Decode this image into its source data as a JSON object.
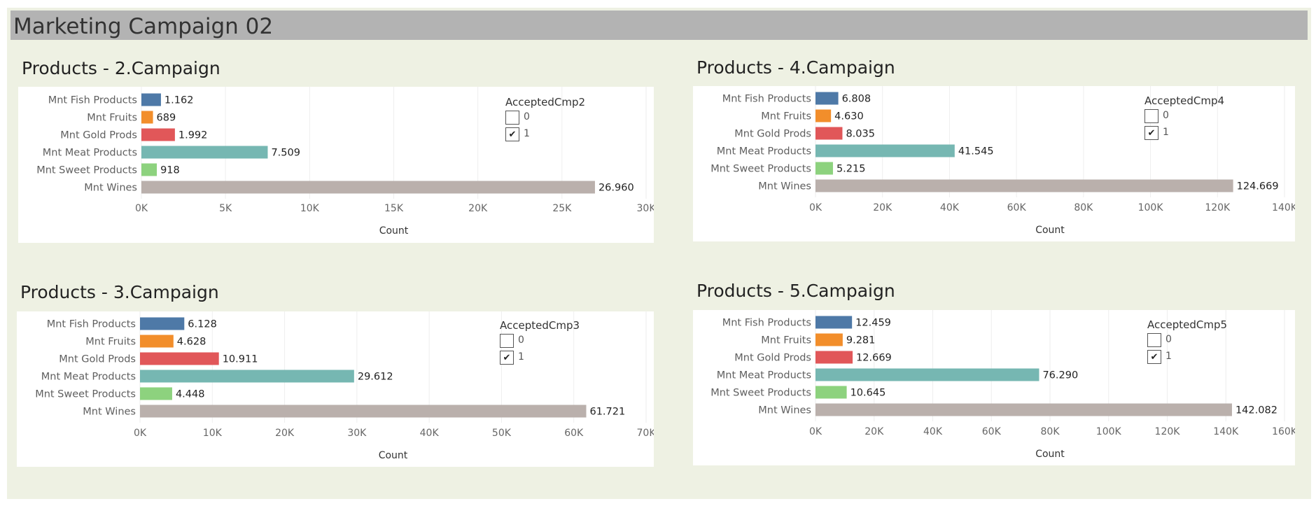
{
  "title": "Marketing Campaign 02",
  "colors": {
    "background": "#eef1e3",
    "title_bar": "#b3b3b3",
    "categories": [
      "#4e79a7",
      "#f28e2b",
      "#e15759",
      "#76b7b2",
      "#8dd27e",
      "#bab0ac"
    ]
  },
  "chart_data": [
    {
      "type": "bar",
      "orientation": "horizontal",
      "title": "Products - 2.Campaign",
      "categories": [
        "Mnt Fish Products",
        "Mnt Fruits",
        "Mnt Gold Prods",
        "Mnt Meat Products",
        "Mnt Sweet Products",
        "Mnt Wines"
      ],
      "values": [
        1162,
        689,
        1992,
        7509,
        918,
        26960
      ],
      "value_labels": [
        "1.162",
        "689",
        "1.992",
        "7.509",
        "918",
        "26.960"
      ],
      "xlabel": "Count",
      "ticks": [
        0,
        5000,
        10000,
        15000,
        20000,
        25000,
        30000
      ],
      "tick_labels": [
        "0K",
        "5K",
        "10K",
        "15K",
        "20K",
        "25K",
        "30K"
      ],
      "xlim": [
        0,
        30000
      ],
      "grid": true,
      "legend": {
        "title": "AcceptedCmp2",
        "placement": "top-right",
        "items": [
          {
            "label": "0",
            "checked": false
          },
          {
            "label": "1",
            "checked": true
          }
        ]
      }
    },
    {
      "type": "bar",
      "orientation": "horizontal",
      "title": "Products - 4.Campaign",
      "categories": [
        "Mnt Fish Products",
        "Mnt Fruits",
        "Mnt Gold Prods",
        "Mnt Meat Products",
        "Mnt Sweet Products",
        "Mnt Wines"
      ],
      "values": [
        6808,
        4630,
        8035,
        41545,
        5215,
        124669
      ],
      "value_labels": [
        "6.808",
        "4.630",
        "8.035",
        "41.545",
        "5.215",
        "124.669"
      ],
      "xlabel": "Count",
      "ticks": [
        0,
        20000,
        40000,
        60000,
        80000,
        100000,
        120000,
        140000
      ],
      "tick_labels": [
        "0K",
        "20K",
        "40K",
        "60K",
        "80K",
        "100K",
        "120K",
        "140K"
      ],
      "xlim": [
        0,
        140000
      ],
      "grid": true,
      "legend": {
        "title": "AcceptedCmp4",
        "placement": "top-right",
        "items": [
          {
            "label": "0",
            "checked": false
          },
          {
            "label": "1",
            "checked": true
          }
        ]
      }
    },
    {
      "type": "bar",
      "orientation": "horizontal",
      "title": "Products - 3.Campaign",
      "categories": [
        "Mnt Fish Products",
        "Mnt Fruits",
        "Mnt Gold Prods",
        "Mnt Meat Products",
        "Mnt Sweet Products",
        "Mnt Wines"
      ],
      "values": [
        6128,
        4628,
        10911,
        29612,
        4448,
        61721
      ],
      "value_labels": [
        "6.128",
        "4.628",
        "10.911",
        "29.612",
        "4.448",
        "61.721"
      ],
      "xlabel": "Count",
      "ticks": [
        0,
        10000,
        20000,
        30000,
        40000,
        50000,
        60000,
        70000
      ],
      "tick_labels": [
        "0K",
        "10K",
        "20K",
        "30K",
        "40K",
        "50K",
        "60K",
        "70K"
      ],
      "xlim": [
        0,
        70000
      ],
      "grid": true,
      "legend": {
        "title": "AcceptedCmp3",
        "placement": "top-right",
        "items": [
          {
            "label": "0",
            "checked": false
          },
          {
            "label": "1",
            "checked": true
          }
        ]
      }
    },
    {
      "type": "bar",
      "orientation": "horizontal",
      "title": "Products - 5.Campaign",
      "categories": [
        "Mnt Fish Products",
        "Mnt Fruits",
        "Mnt Gold Prods",
        "Mnt Meat Products",
        "Mnt Sweet Products",
        "Mnt Wines"
      ],
      "values": [
        12459,
        9281,
        12669,
        76290,
        10645,
        142082
      ],
      "value_labels": [
        "12.459",
        "9.281",
        "12.669",
        "76.290",
        "10.645",
        "142.082"
      ],
      "xlabel": "Count",
      "ticks": [
        0,
        20000,
        40000,
        60000,
        80000,
        100000,
        120000,
        140000,
        160000
      ],
      "tick_labels": [
        "0K",
        "20K",
        "40K",
        "60K",
        "80K",
        "100K",
        "120K",
        "140K",
        "160K"
      ],
      "xlim": [
        0,
        160000
      ],
      "grid": true,
      "legend": {
        "title": "AcceptedCmp5",
        "placement": "top-right",
        "items": [
          {
            "label": "0",
            "checked": false
          },
          {
            "label": "1",
            "checked": true
          }
        ]
      }
    }
  ]
}
